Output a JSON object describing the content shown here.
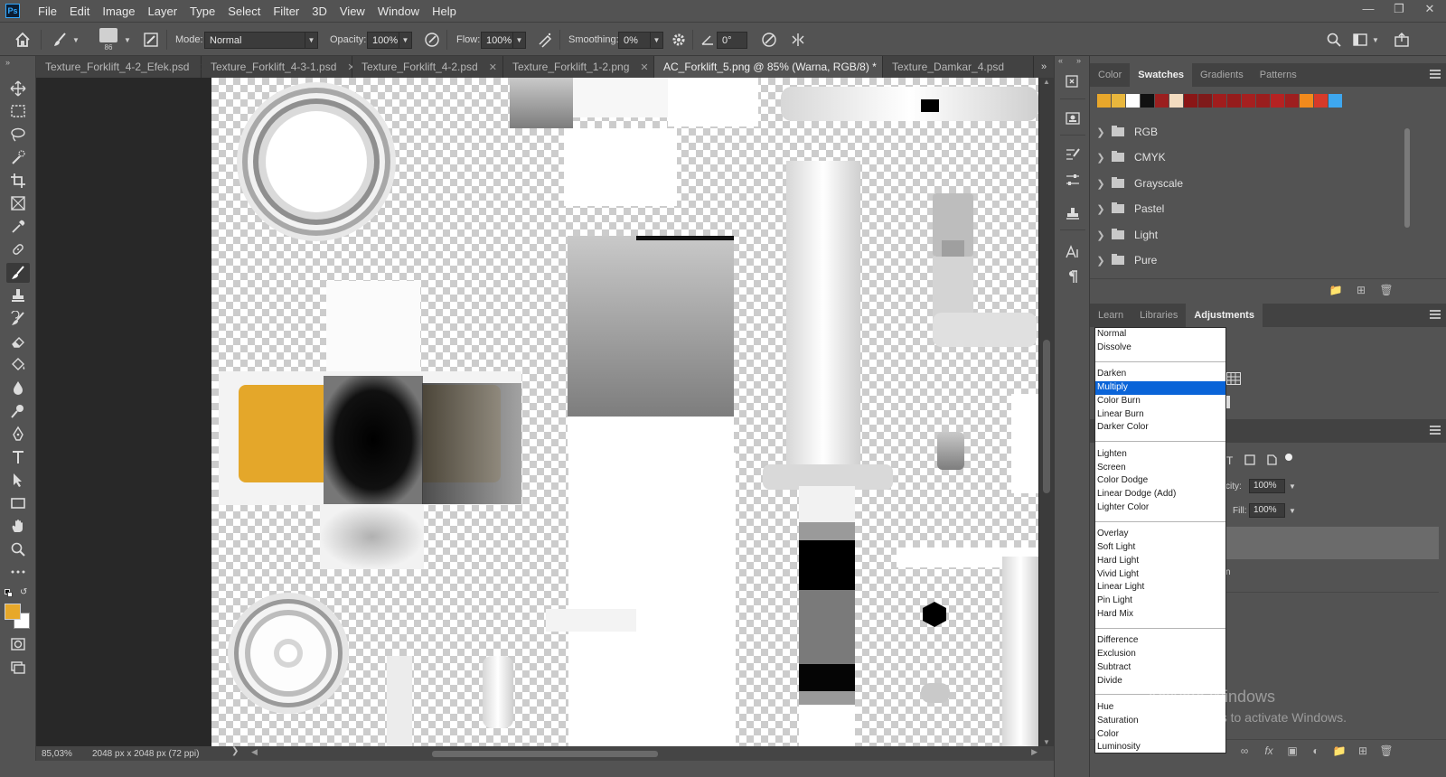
{
  "app": {
    "logo_text": "Ps"
  },
  "menu": [
    "File",
    "Edit",
    "Image",
    "Layer",
    "Type",
    "Select",
    "Filter",
    "3D",
    "View",
    "Window",
    "Help"
  ],
  "options_bar": {
    "brush_size": "86",
    "mode_label": "Mode:",
    "mode_value": "Normal",
    "opacity_label": "Opacity:",
    "opacity_value": "100%",
    "flow_label": "Flow:",
    "flow_value": "100%",
    "smoothing_label": "Smoothing:",
    "smoothing_value": "0%",
    "angle_value": "0°"
  },
  "tabs": [
    {
      "label": "Texture_Forklift_4-2_Efek.psd",
      "active": false
    },
    {
      "label": "Texture_Forklift_4-3-1.psd",
      "active": false
    },
    {
      "label": "Texture_Forklift_4-2.psd",
      "active": false
    },
    {
      "label": "Texture_Forklift_1-2.png",
      "active": false
    },
    {
      "label": "AC_Forklift_5.png @ 85% (Warna, RGB/8) *",
      "active": true
    },
    {
      "label": "Texture_Damkar_4.psd",
      "active": false
    }
  ],
  "colors": {
    "foreground": "#e7a82a",
    "background": "#ffffff",
    "accent": "#0a64d8"
  },
  "status": {
    "zoom": "85,03%",
    "doc_size": "2048 px x 2048 px (72 ppi)"
  },
  "swatches_panel": {
    "tabs": [
      {
        "label": "Color",
        "active": false
      },
      {
        "label": "Swatches",
        "active": true
      },
      {
        "label": "Gradients",
        "active": false
      },
      {
        "label": "Patterns",
        "active": false
      }
    ],
    "recent": [
      "#e8a72b",
      "#e9b73d",
      "#ffffff",
      "#111111",
      "#9b1f1f",
      "#f3dcc0",
      "#8a1616",
      "#7f1a1a",
      "#a01d1d",
      "#951c1c",
      "#a52020",
      "#9a1e1e",
      "#b52222",
      "#9e1f1f",
      "#f28a1c",
      "#d63a2a",
      "#3ea7ef"
    ],
    "groups": [
      "RGB",
      "CMYK",
      "Grayscale",
      "Pastel",
      "Light",
      "Pure"
    ]
  },
  "adjust_panel": {
    "tabs": [
      {
        "label": "Learn",
        "active": false
      },
      {
        "label": "Libraries",
        "active": false
      },
      {
        "label": "Adjustments",
        "active": true
      }
    ]
  },
  "layers_panel": {
    "opacity_label": "city:",
    "opacity_value": "100%",
    "fill_label": "Fill:",
    "fill_value": "100%"
  },
  "blend_modes": {
    "selected": "Multiply",
    "groups": [
      [
        "Normal",
        "Dissolve"
      ],
      [
        "Darken",
        "Multiply",
        "Color Burn",
        "Linear Burn",
        "Darker Color"
      ],
      [
        "Lighten",
        "Screen",
        "Color Dodge",
        "Linear Dodge (Add)",
        "Lighter Color"
      ],
      [
        "Overlay",
        "Soft Light",
        "Hard Light",
        "Vivid Light",
        "Linear Light",
        "Pin Light",
        "Hard Mix"
      ],
      [
        "Difference",
        "Exclusion",
        "Subtract",
        "Divide"
      ],
      [
        "Hue",
        "Saturation",
        "Color",
        "Luminosity"
      ]
    ]
  },
  "watermark": {
    "title": "Activate Windows",
    "subtitle": "Go to Settings to activate Windows."
  }
}
